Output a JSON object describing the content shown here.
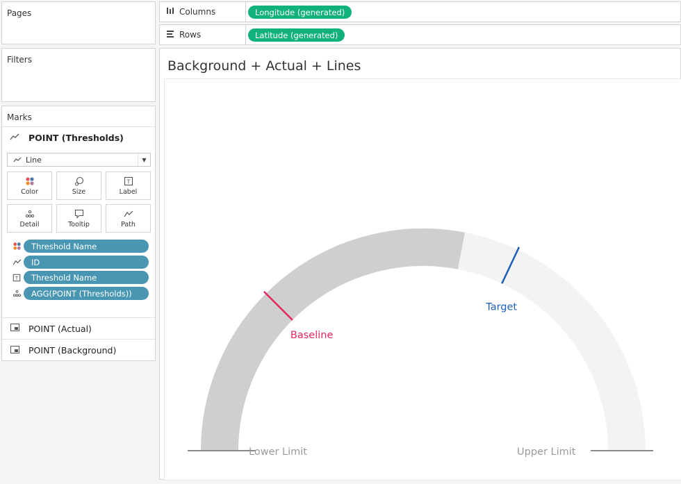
{
  "pages": {
    "title": "Pages"
  },
  "filters": {
    "title": "Filters"
  },
  "marks": {
    "title": "Marks",
    "sections": [
      {
        "label": "POINT (Thresholds)",
        "icon": "line-mark-icon"
      },
      {
        "label": "POINT (Actual)",
        "icon": "automatic-mark-icon"
      },
      {
        "label": "POINT (Background)",
        "icon": "automatic-mark-icon"
      }
    ],
    "mark_type": "Line",
    "buttons": [
      {
        "label": "Color",
        "icon": "color-icon"
      },
      {
        "label": "Size",
        "icon": "size-icon"
      },
      {
        "label": "Label",
        "icon": "label-icon"
      },
      {
        "label": "Detail",
        "icon": "detail-icon"
      },
      {
        "label": "Tooltip",
        "icon": "tooltip-icon"
      },
      {
        "label": "Path",
        "icon": "path-icon"
      }
    ],
    "fields": [
      {
        "label": "Threshold Name",
        "icon": "color-icon"
      },
      {
        "label": "ID",
        "icon": "path-icon"
      },
      {
        "label": "Threshold Name",
        "icon": "label-icon"
      },
      {
        "label": "AGG(POINT (Thresholds))",
        "icon": "detail-icon"
      }
    ]
  },
  "shelves": {
    "columns": {
      "label": "Columns",
      "pill": "Longitude (generated)"
    },
    "rows": {
      "label": "Rows",
      "pill": "Latitude (generated)"
    }
  },
  "view": {
    "title": "Background + Actual + Lines",
    "labels": {
      "baseline": "Baseline",
      "target": "Target",
      "lower_limit": "Lower Limit",
      "upper_limit": "Upper Limit"
    },
    "gauge": {
      "actual_fraction": 0.56,
      "baseline_fraction": 0.25,
      "target_fraction": 0.64
    },
    "colors": {
      "actual": "#cfcfcf",
      "background": "#f3f3f3",
      "baseline": "#e8265d",
      "target": "#1d5fb8",
      "limit_line": "#8a8a8a",
      "limit_text": "#9a9a9a",
      "pill_green": "#10b27a",
      "pill_blue": "#4996b2"
    }
  }
}
